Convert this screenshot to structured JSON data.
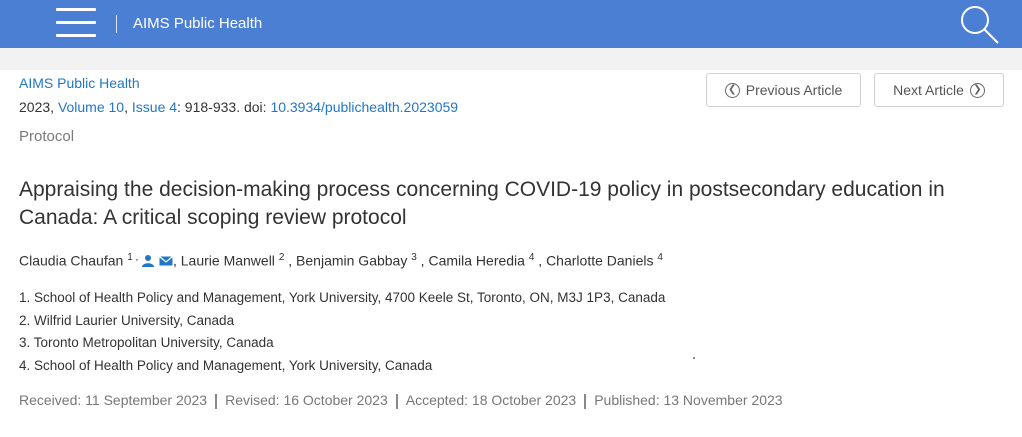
{
  "header": {
    "site_title": "AIMS Public Health",
    "menu_icon": "hamburger-menu-icon",
    "search_icon": "search-icon",
    "bar_color": "#4a7fd4"
  },
  "article": {
    "journal": "AIMS Public Health",
    "citation": {
      "year_prefix": "2023, ",
      "volume": "Volume 10",
      "sep1": ", ",
      "issue": "Issue 4",
      "pages": ": 918-933. doi: ",
      "doi": "10.3934/publichealth.2023059"
    },
    "type": "Protocol",
    "title": "Appraising the decision-making process concerning COVID-19 policy in postsecondary education in Canada: A critical scoping review protocol",
    "authors": [
      {
        "name": "Claudia Chaufan ",
        "sup": "1 , "
      },
      {
        "name": ", Laurie Manwell ",
        "sup": "2"
      },
      {
        "name": " , Benjamin Gabbay ",
        "sup": "3"
      },
      {
        "name": " , Camila Heredia ",
        "sup": "4"
      },
      {
        "name": " , Charlotte Daniels ",
        "sup": "4"
      }
    ],
    "affiliations": [
      "1. School of Health Policy and Management, York University, 4700 Keele St, Toronto, ON, M3J 1P3, Canada",
      "2. Wilfrid Laurier University, Canada",
      "3. Toronto Metropolitan University, Canada",
      "4. School of Health Policy and Management, York University, Canada"
    ],
    "dates": {
      "received": "Received: 11 September 2023",
      "revised": "Revised: 16 October 2023",
      "accepted": "Accepted: 18 October 2023",
      "published": "Published: 13 November 2023"
    }
  },
  "nav": {
    "prev_label": "Previous Article",
    "next_label": "Next Article",
    "prev_icon": "chevron-left-circle-icon",
    "next_icon": "chevron-right-circle-icon"
  },
  "colors": {
    "link": "#1f77c8",
    "text": "#333333",
    "muted": "#777777"
  }
}
